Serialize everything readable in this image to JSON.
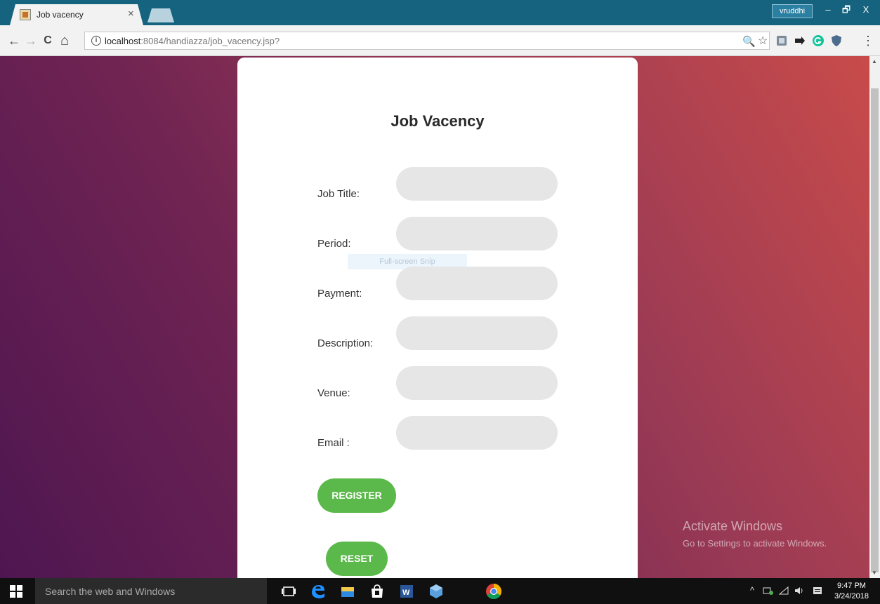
{
  "browser": {
    "tab_title": "Job vacency",
    "tab_close": "×",
    "user_name": "vruddhi",
    "window_controls": {
      "minimize": "–",
      "restore": "🗗",
      "close": "X"
    },
    "nav": {
      "back": "←",
      "forward": "→",
      "reload": "C",
      "home": "⌂"
    },
    "url_host": "localhost",
    "url_path": ":8084/handiazza/job_vacency.jsp?",
    "omnibox_icons": {
      "zoom": "🔍",
      "bookmark": "☆"
    },
    "menu_icon": "⋮"
  },
  "page": {
    "title": "Job Vacency",
    "fields": [
      {
        "label": "Job Title:",
        "value": ""
      },
      {
        "label": "Period:",
        "value": ""
      },
      {
        "label": "Payment:",
        "value": ""
      },
      {
        "label": "Description:",
        "value": ""
      },
      {
        "label": "Venue:",
        "value": ""
      },
      {
        "label": "Email :",
        "value": ""
      }
    ],
    "register_label": "REGISTER",
    "reset_label": "RESET",
    "snip_overlay": "Full-screen Snip",
    "accent_color": "#5bb84a"
  },
  "watermark": {
    "title": "Activate Windows",
    "subtitle": "Go to Settings to activate Windows."
  },
  "taskbar": {
    "search_placeholder": "Search the web and Windows",
    "tray_chevron": "^",
    "time": "9:47 PM",
    "date": "3/24/2018"
  }
}
